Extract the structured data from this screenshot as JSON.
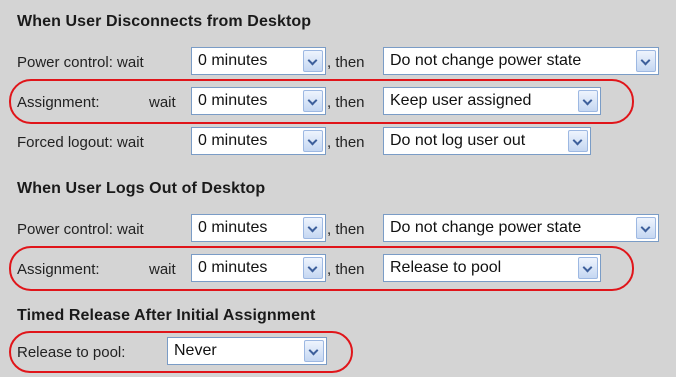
{
  "sections": {
    "disconnect": {
      "heading": "When User Disconnects from Desktop",
      "power": {
        "label": "Power control: wait",
        "wait": "0 minutes",
        "then": ", then",
        "action": "Do not change power state"
      },
      "assignment": {
        "label": "Assignment:",
        "wait_label": "wait",
        "wait": "0 minutes",
        "then": ", then",
        "action": "Keep user assigned"
      },
      "logout": {
        "label": "Forced logout: wait",
        "wait": "0 minutes",
        "then": ", then",
        "action": "Do not log user out"
      }
    },
    "logout": {
      "heading": "When User Logs Out of Desktop",
      "power": {
        "label": "Power control: wait",
        "wait": "0 minutes",
        "then": ", then",
        "action": "Do not change power state"
      },
      "assignment": {
        "label": "Assignment:",
        "wait_label": "wait",
        "wait": "0 minutes",
        "then": ", then",
        "action": "Release to pool"
      }
    },
    "timed": {
      "heading": "Timed Release After Initial Assignment",
      "release": {
        "label": "Release to pool:",
        "value": "Never"
      }
    }
  },
  "colors": {
    "highlight": "#e0151a",
    "background": "#d4d4d4",
    "select_border": "#7a9cc6"
  }
}
